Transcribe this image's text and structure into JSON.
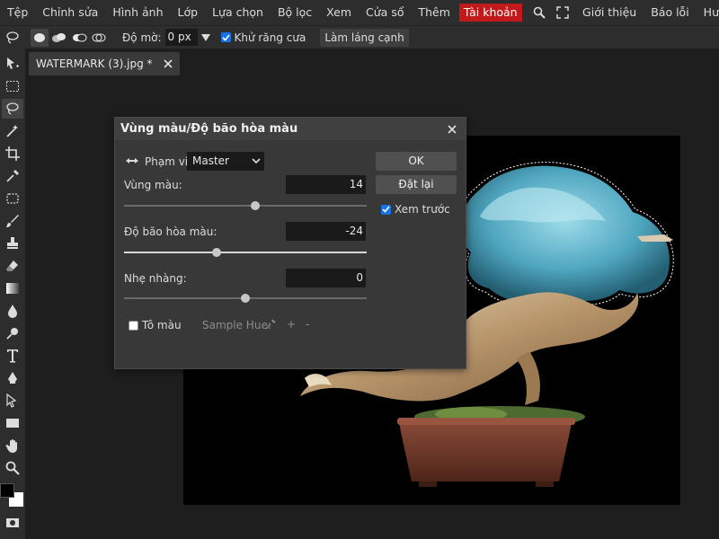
{
  "menubar": {
    "items": [
      "Tệp",
      "Chỉnh sửa",
      "Hình ảnh",
      "Lớp",
      "Lựa chọn",
      "Bộ lọc",
      "Xem",
      "Cửa sổ",
      "Thêm"
    ],
    "account": "Tài khoản",
    "right_items": [
      "Giới thiệu",
      "Báo lỗi",
      "Hư"
    ]
  },
  "options_bar": {
    "feather_label": "Độ mờ:",
    "feather_value": "0 px",
    "antialias_label": "Khử răng cưa",
    "antialias_checked": true,
    "refine_button": "Làm láng cạnh"
  },
  "document": {
    "tab_title": "WATERMARK (3).jpg *"
  },
  "dialog": {
    "title": "Vùng màu/Độ bão hòa màu",
    "range_label": "Phạm vi:",
    "range_value": "Master",
    "hue": {
      "label": "Vùng màu:",
      "value": "14",
      "fraction": 0.54
    },
    "saturation": {
      "label": "Độ bão hòa màu:",
      "value": "-24",
      "fraction": 0.38
    },
    "lightness": {
      "label": "Nhẹ nhàng:",
      "value": "0",
      "fraction": 0.5
    },
    "colorize_label": "Tô màu",
    "colorize_checked": false,
    "sample_hue_label": "Sample Hue:",
    "plus": "+",
    "minus": "-",
    "ok_button": "OK",
    "reset_button": "Đặt lại",
    "preview_label": "Xem trước",
    "preview_checked": true
  },
  "colors": {
    "accent": "#1473e6",
    "account_red": "#c21a1a",
    "foreground": "#000000",
    "background": "#ffffff"
  }
}
